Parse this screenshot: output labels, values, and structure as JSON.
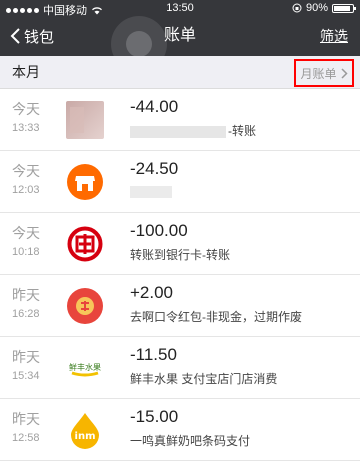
{
  "status_bar": {
    "carrier": "中国移动",
    "time": "13:50",
    "battery": "90%",
    "battery_level": 0.9
  },
  "nav": {
    "back_label": "钱包",
    "title": "账单",
    "filter_label": "筛选"
  },
  "section": {
    "label": "本月",
    "monthly_bill_label": "月账单"
  },
  "transactions": [
    {
      "day": "今天",
      "time": "13:33",
      "amount": "-44.00",
      "desc": "-转账",
      "icon": "blurred-avatar-icon"
    },
    {
      "day": "今天",
      "time": "12:03",
      "amount": "-24.50",
      "desc": "",
      "icon": "store-icon"
    },
    {
      "day": "今天",
      "time": "10:18",
      "amount": "-100.00",
      "desc": "转账到银行卡-转账",
      "icon": "icbc-bank-icon"
    },
    {
      "day": "昨天",
      "time": "16:28",
      "amount": "+2.00",
      "desc": "去啊口令红包-非现金，过期作废",
      "icon": "red-envelope-icon"
    },
    {
      "day": "昨天",
      "time": "15:34",
      "amount": "-11.50",
      "desc": "鲜丰水果 支付宝店门店消费",
      "icon": "fruit-store-logo-icon"
    },
    {
      "day": "昨天",
      "time": "12:58",
      "amount": "-15.00",
      "desc": "一鸣真鲜奶吧条码支付",
      "icon": "milk-bar-logo-icon"
    }
  ],
  "logo_text": {
    "fruit": "鲜丰水果",
    "milk": "inm"
  }
}
